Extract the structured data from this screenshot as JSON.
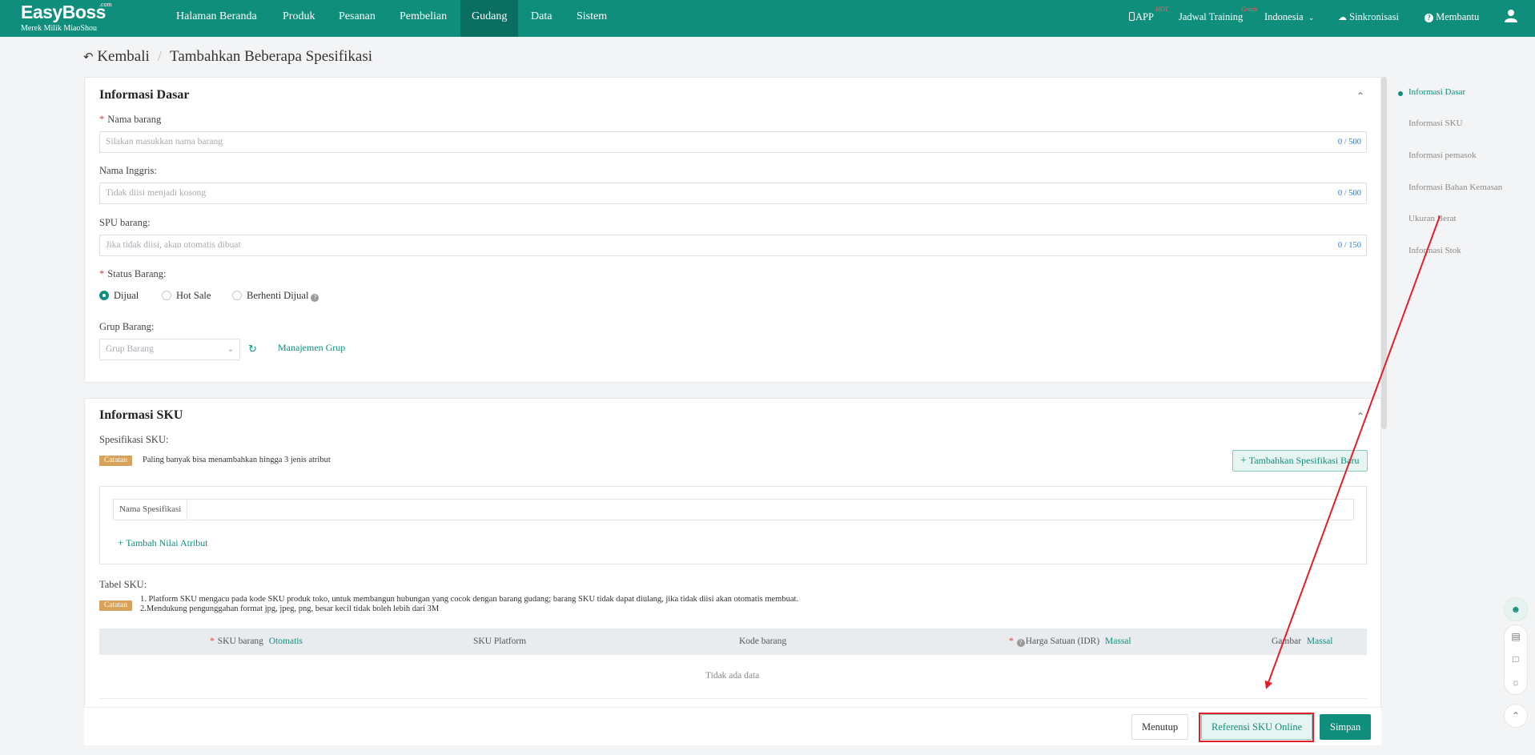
{
  "brand": {
    "name": "EasyBoss",
    "com": ".com",
    "sub": "Merek Milik MiaoShou"
  },
  "nav": {
    "items": [
      "Halaman Beranda",
      "Produk",
      "Pesanan",
      "Pembelian",
      "Gudang",
      "Data",
      "Sistem"
    ],
    "active": "Gudang"
  },
  "nav_right": {
    "app": "APP",
    "app_badge": "HOT",
    "training": "Jadwal Training",
    "training_badge": "Gratis",
    "language": "Indonesia",
    "sync": "Sinkronisasi",
    "help": "Membantu"
  },
  "breadcrumb": {
    "back": "Kembali",
    "sep": "/",
    "current": "Tambahkan Beberapa Spesifikasi"
  },
  "basic": {
    "title": "Informasi Dasar",
    "name_label": "Nama barang",
    "name_placeholder": "Silakan masukkan nama barang",
    "name_count": "0 / 500",
    "en_label": "Nama Inggris:",
    "en_placeholder": "Tidak diisi menjadi kosong",
    "en_count": "0 / 500",
    "spu_label": "SPU barang:",
    "spu_placeholder": "Jika tidak diisi, akan otomatis dibuat",
    "spu_count": "0 / 150",
    "status_label": "Status Barang:",
    "status_options": [
      "Dijual",
      "Hot Sale",
      "Berhenti Dijual"
    ],
    "status_selected": "Dijual",
    "group_label": "Grup Barang:",
    "group_placeholder": "Grup Barang",
    "group_manage": "Manajemen Grup"
  },
  "sku": {
    "title": "Informasi SKU",
    "spec_label": "Spesifikasi SKU:",
    "note_tag": "Catatan",
    "spec_note": "Paling banyak bisa menambahkan hingga 3 jenis atribut",
    "add_spec_button": "Tambahkan Spesifikasi Baru",
    "spec_name_label": "Nama Spesifikasi",
    "add_attr_value": "Tambah Nilai Atribut",
    "table_label": "Tabel SKU:",
    "table_note_1": "1. Platform SKU mengacu pada kode SKU produk toko, untuk membangun hubungan yang cocok dengan barang gudang; barang SKU tidak dapat diulang, jika tidak diisi akan otomatis membuat.",
    "table_note_2": "2.Mendukung pengunggahan format jpg, jpeg, png, besar kecil tidak boleh lebih dari 3M",
    "columns": {
      "sku_barang": "SKU barang",
      "otomatis": "Otomatis",
      "sku_platform": "SKU Platform",
      "kode_barang": "Kode barang",
      "harga": "Harga Satuan (IDR)",
      "massal_1": "Massal",
      "gambar": "Gambar",
      "massal_2": "Massal"
    },
    "empty_text": "Tidak ada data"
  },
  "anchors": [
    "Informasi Dasar",
    "Informasi SKU",
    "Informasi pemasok",
    "Informasi Bahan Kemasan",
    "Ukuran Berat",
    "Informasi Stok"
  ],
  "footer": {
    "close": "Menutup",
    "reference": "Referensi SKU Online",
    "save": "Simpan"
  },
  "colors": {
    "primary": "#0f8e7c",
    "annotation": "#e0202a",
    "note_tag": "#d6a25c"
  }
}
